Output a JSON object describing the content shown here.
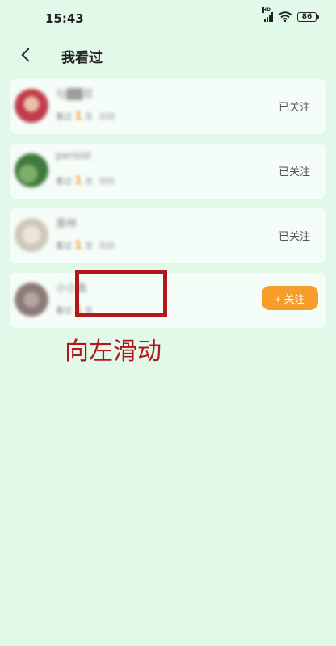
{
  "status_bar": {
    "time": "15:43",
    "hd": "HD",
    "battery": "86",
    "icons": [
      "signal-icon",
      "wifi-icon",
      "battery-icon"
    ]
  },
  "header": {
    "title": "我看过",
    "back_icon": "chevron-left-icon"
  },
  "list": [
    {
      "name": "与▓▓邓",
      "meta_prefix": "看过",
      "count": "1",
      "meta_suffix": "次",
      "time": "刚刚",
      "status": "已关注",
      "avatar_color": "#c23b4a"
    },
    {
      "name": "persist",
      "meta_prefix": "看过",
      "count": "1",
      "meta_suffix": "次",
      "time": "刚刚",
      "status": "已关注",
      "avatar_color": "#3f7a3c"
    },
    {
      "name": "墨林",
      "meta_prefix": "看过",
      "count": "1",
      "meta_suffix": "次",
      "time": "刚刚",
      "status": "已关注",
      "avatar_color": "#cfc7bb"
    },
    {
      "name": "小小鱼",
      "meta_prefix": "看过",
      "count": "1",
      "meta_suffix": "次",
      "time": "",
      "button": "+ 关注",
      "avatar_color": "#8c7a78"
    }
  ],
  "annotation": {
    "text": "向左滑动",
    "color": "#b2171b"
  },
  "colors": {
    "background": "#e2f9ea",
    "accent": "#f79d2a"
  }
}
